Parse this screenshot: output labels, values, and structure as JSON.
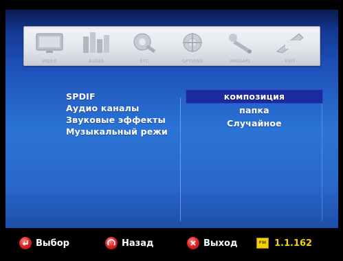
{
  "toolbar": {
    "items": [
      {
        "icon": "video-icon",
        "caption": "VIDEO"
      },
      {
        "icon": "audio-icon",
        "caption": "AUDIO"
      },
      {
        "icon": "etc-icon",
        "caption": "ETC"
      },
      {
        "icon": "options-icon",
        "caption": "OPTIONS"
      },
      {
        "icon": "mediaplayer-icon",
        "caption": "MEDIAPL"
      },
      {
        "icon": "exit-icon",
        "caption": "EXIT"
      }
    ]
  },
  "menu": {
    "items": [
      {
        "label": "SPDIF"
      },
      {
        "label": "Аудио каналы"
      },
      {
        "label": "Звуковые эффекты"
      },
      {
        "label": "Музыкальный режи"
      }
    ]
  },
  "options": {
    "items": [
      {
        "label": "композиция",
        "selected": true
      },
      {
        "label": "папка",
        "selected": false
      },
      {
        "label": "Случайное",
        "selected": false
      }
    ]
  },
  "footer": {
    "select_label": "Выбор",
    "back_label": "Назад",
    "exit_label": "Выход",
    "fw_badge": "FW",
    "fw_version": "1.1.162"
  },
  "colors": {
    "background_top": "#0f2a7a",
    "background_mid": "#2c73d6",
    "selection": "#1b2a9e",
    "fw_yellow": "#f2d200",
    "button_red": "#e12626"
  }
}
